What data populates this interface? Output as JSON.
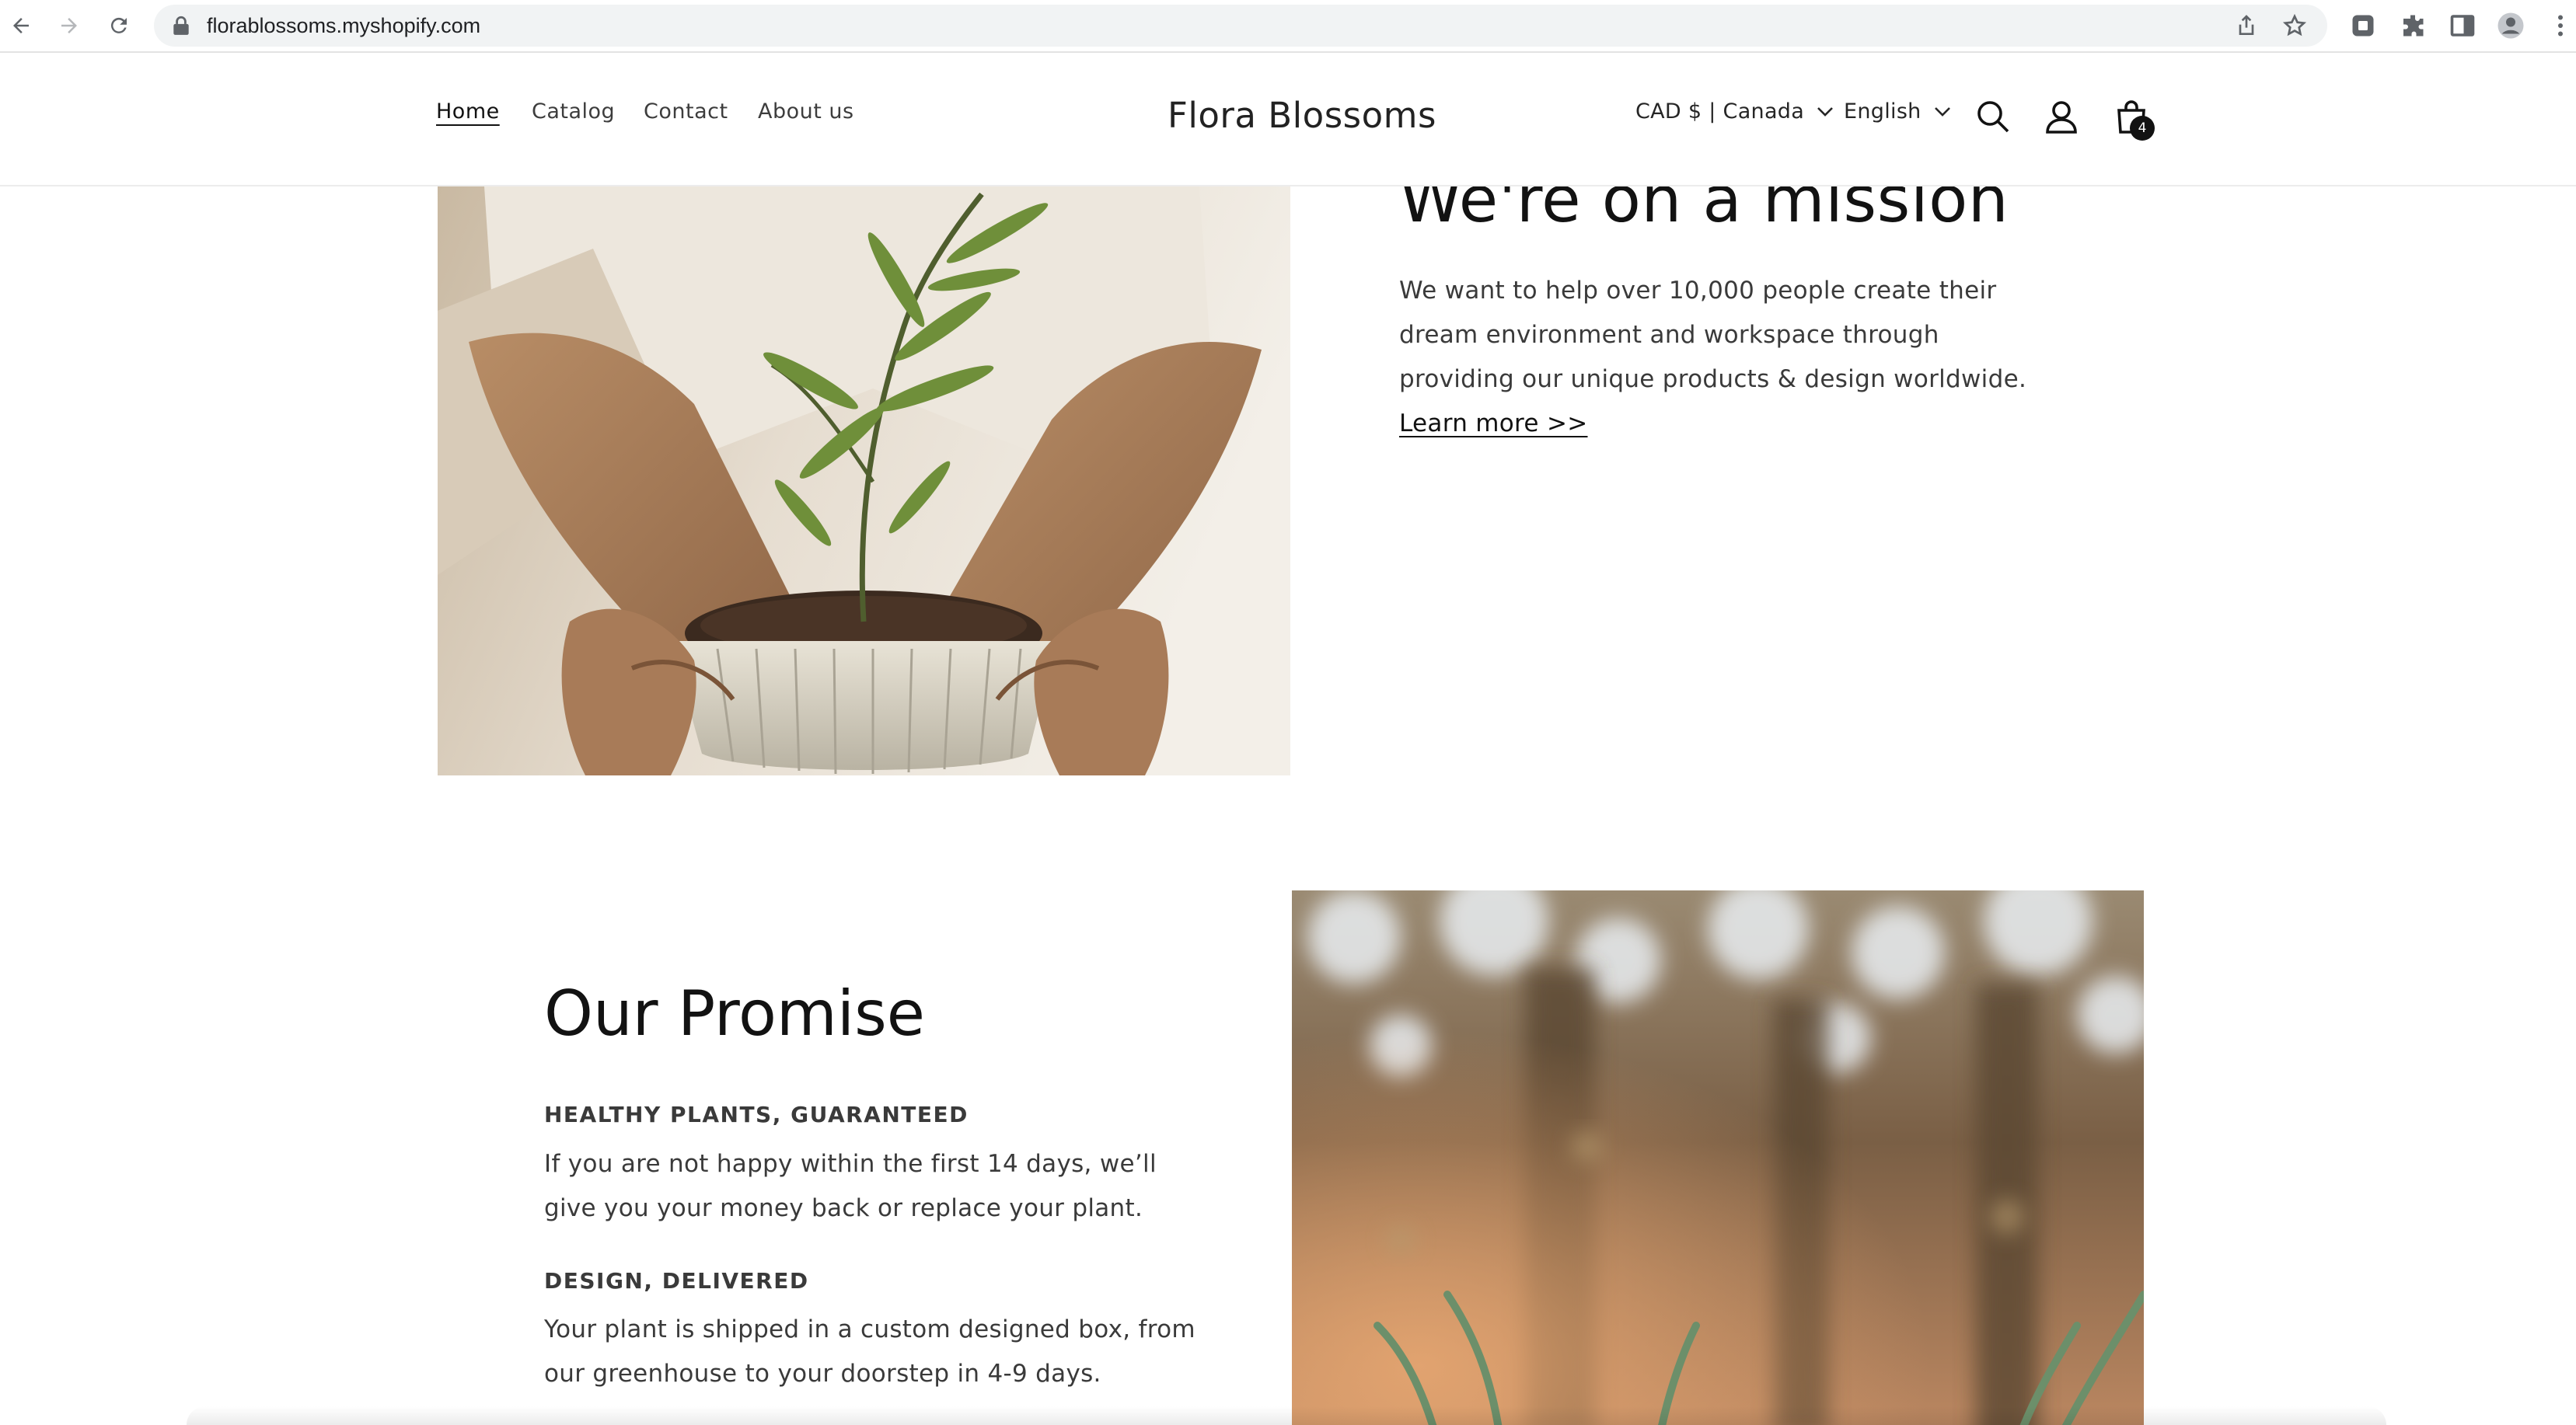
{
  "browser": {
    "url": "florablossoms.myshopify.com"
  },
  "header": {
    "nav": [
      {
        "label": "Home",
        "active": true
      },
      {
        "label": "Catalog",
        "active": false
      },
      {
        "label": "Contact",
        "active": false
      },
      {
        "label": "About us",
        "active": false
      }
    ],
    "logo": "Flora Blossoms",
    "country_selector": "CAD $ | Canada",
    "language_selector": "English",
    "cart_count": "4"
  },
  "mission": {
    "heading": "We're on a mission",
    "body": "We want to help over 10,000 people create their dream environment and workspace through providing our unique products & design worldwide.",
    "link": "Learn more >>"
  },
  "promise": {
    "heading": "Our Promise",
    "items": [
      {
        "title": "HEALTHY PLANTS, GUARANTEED",
        "text": "If you are not happy within the first 14 days, we’ll give you your money back or replace your plant."
      },
      {
        "title": "DESIGN, DELIVERED",
        "text": "Your plant is shipped in a custom designed box, from our greenhouse to your doorstep in 4-9 days."
      }
    ]
  },
  "colors": {
    "text": "#121212",
    "body_text": "#3a3a3a",
    "omnibox": "#f1f3f4",
    "cart_badge": "#121212"
  },
  "icons": [
    "back-arrow-icon",
    "forward-arrow-icon",
    "reload-icon",
    "lock-icon",
    "share-icon",
    "star-icon",
    "extension-icon",
    "puzzle-icon",
    "side-panel-icon",
    "profile-icon",
    "kebab-menu-icon",
    "chevron-down-icon",
    "search-icon",
    "account-icon",
    "cart-icon"
  ]
}
